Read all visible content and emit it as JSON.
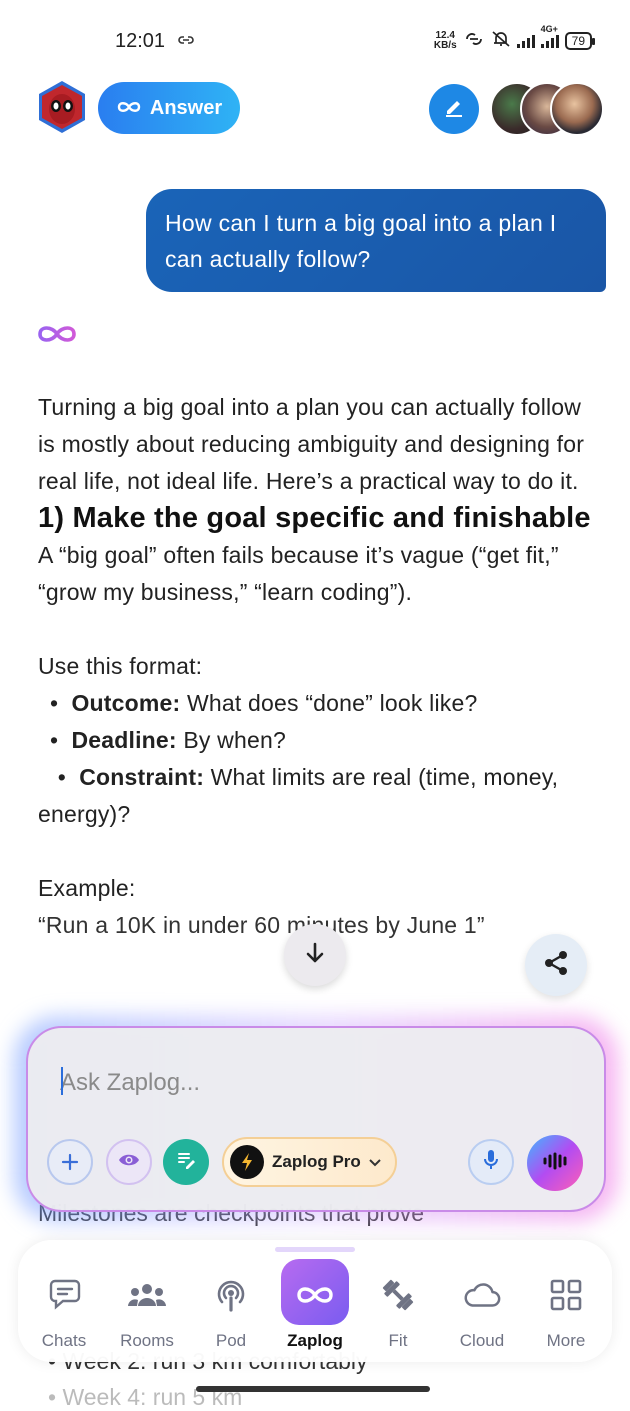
{
  "status_bar": {
    "time": "12:01",
    "net_speed_top": "12.4",
    "net_speed_unit": "KB/s",
    "network": "4G+",
    "battery": "79"
  },
  "header": {
    "mode_label": "Answer"
  },
  "conversation": {
    "user_message": "How can I turn a big goal into a plan I can actually follow?",
    "answer_intro": "Turning a big goal into a plan you can actually follow is mostly about reducing ambiguity and designing for real life, not ideal life. Here’s a practical way to do it.",
    "section1_heading": "1) Make the goal specific and finishable",
    "section1_text": "A “big goal” often fails because it’s vague (“get fit,” “grow my business,” “learn coding”).",
    "format_intro": "Use this format:",
    "bullets": [
      {
        "term": "Outcome:",
        "text": " What does “done” look like?"
      },
      {
        "term": "Deadline:",
        "text": " By when?"
      },
      {
        "term": "Constraint:",
        "text": " What limits are real (time, money, energy)?"
      }
    ],
    "example_label": "Example:",
    "example_partial": "“Run a 10K in under 60 minutes by June 1”",
    "milestones_partial": "Milestones are checkpoints that prove",
    "week2_partial": "• Week 2: run 3 km comfortably",
    "week4_partial": "• Week 4: run 5 km"
  },
  "composer": {
    "placeholder": "Ask Zaplog...",
    "model_name": "Zaplog Pro"
  },
  "nav": {
    "items": [
      {
        "label": "Chats",
        "icon": "chat-bubbles-icon"
      },
      {
        "label": "Rooms",
        "icon": "people-group-icon"
      },
      {
        "label": "Pod",
        "icon": "podcast-icon"
      },
      {
        "label": "Zaplog",
        "icon": "infinity-icon"
      },
      {
        "label": "Fit",
        "icon": "dumbbell-icon"
      },
      {
        "label": "Cloud",
        "icon": "cloud-icon"
      },
      {
        "label": "More",
        "icon": "grid-icon"
      }
    ],
    "active": "Zaplog"
  },
  "colors": {
    "accent_blue": "#1e88e5",
    "user_bubble": "#1a5fae",
    "zaplog_purple": "#9b63f0",
    "share_teal": "#22b39b"
  }
}
